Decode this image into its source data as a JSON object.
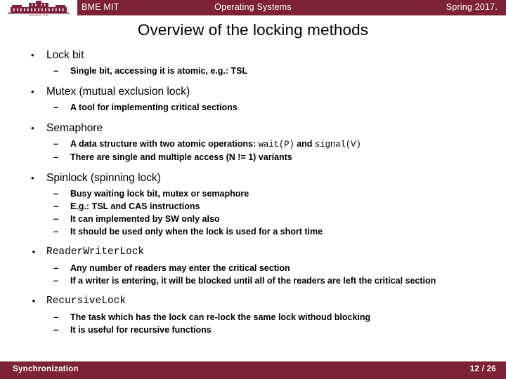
{
  "theme": {
    "brand_color": "#7d2239",
    "text_color": "#000000",
    "background": "#ffffff"
  },
  "header": {
    "logo_caption": "BUDAPEST 1782",
    "title": "BME MIT",
    "center": "Operating Systems",
    "right": "Spring 2017."
  },
  "slide": {
    "title": "Overview of the locking methods"
  },
  "content": {
    "groups": [
      {
        "heading": "Lock bit",
        "items": [
          {
            "parts": [
              {
                "type": "text",
                "value": "Single bit, accessing it is atomic, e.g.: TSL"
              }
            ]
          }
        ]
      },
      {
        "heading": "Mutex (mutual exclusion lock)",
        "items": [
          {
            "parts": [
              {
                "type": "text",
                "value": "A tool for implementing critical sections"
              }
            ]
          }
        ]
      },
      {
        "heading": "Semaphore",
        "items": [
          {
            "parts": [
              {
                "type": "text",
                "value": "A data structure with two atomic operations: "
              },
              {
                "type": "code",
                "value": "wait(P)"
              },
              {
                "type": "text",
                "value": " and "
              },
              {
                "type": "code",
                "value": "signal(V)"
              }
            ]
          },
          {
            "parts": [
              {
                "type": "text",
                "value": "There are single and multiple access (N != 1) variants"
              }
            ]
          }
        ]
      },
      {
        "heading": "Spinlock (spinning lock)",
        "items": [
          {
            "parts": [
              {
                "type": "text",
                "value": "Busy waiting lock bit, mutex or semaphore"
              }
            ]
          },
          {
            "parts": [
              {
                "type": "text",
                "value": "E.g.: TSL and CAS instructions"
              }
            ]
          },
          {
            "parts": [
              {
                "type": "text",
                "value": "It can implemented by SW only also"
              }
            ]
          },
          {
            "parts": [
              {
                "type": "text",
                "value": "It should be used only when the lock is used for a short time"
              }
            ]
          }
        ]
      },
      {
        "heading": "ReaderWriterLock",
        "heading_mono": true,
        "items": [
          {
            "parts": [
              {
                "type": "text",
                "value": "Any number of readers may enter the critical section"
              }
            ]
          },
          {
            "parts": [
              {
                "type": "text",
                "value": "If a writer is entering, it will be blocked until all of the readers are left the critical section"
              }
            ]
          }
        ]
      },
      {
        "heading": "RecursiveLock",
        "heading_mono": true,
        "items": [
          {
            "parts": [
              {
                "type": "text",
                "value": "The task which has the lock can re-lock the same lock withoud blocking"
              }
            ]
          },
          {
            "parts": [
              {
                "type": "text",
                "value": "It is useful for recursive functions"
              }
            ]
          }
        ]
      }
    ]
  },
  "footer": {
    "left": "Synchronization",
    "right": "12 / 26"
  }
}
